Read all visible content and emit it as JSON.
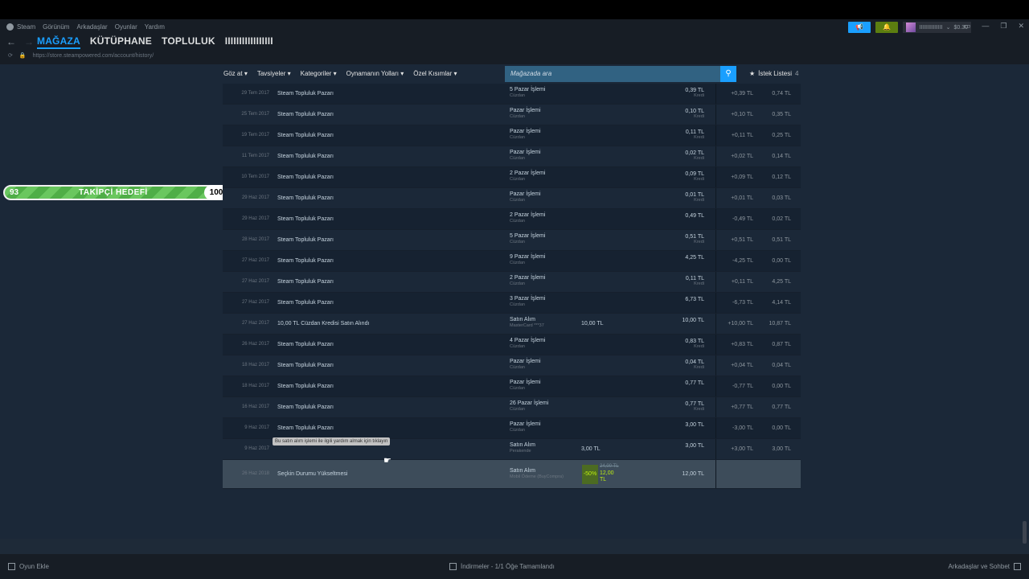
{
  "menu": {
    "steam": "Steam",
    "view": "Görünüm",
    "friends": "Arkadaşlar",
    "games": "Oyunlar",
    "help": "Yardım"
  },
  "tabs": {
    "store": "MAĞAZA",
    "library": "KÜTÜPHANE",
    "community": "TOPLULUK",
    "username": "IIIIIIIIIIIIIIIII"
  },
  "url": "https://store.steampowered.com/account/history/",
  "user": {
    "name": "IIIIIIIIIIIIIII",
    "balance": "$0.30"
  },
  "storenav": {
    "yourstore": "Göz at",
    "recommendations": "Tavsiyeler",
    "categories": "Kategoriler",
    "ways": "Oynamanın Yolları",
    "special": "Özel Kısımlar",
    "search_placeholder": "Mağazada ara",
    "wishlist": "İstek Listesi",
    "wishlist_count": "4"
  },
  "goal": {
    "start": "93",
    "label": "TAKİPÇİ HEDEFİ",
    "end": "100"
  },
  "rows": [
    {
      "date": "29 Tem 2017",
      "item": "Steam Topluluk Pazarı",
      "type": "5 Pazar İşlemi",
      "sub": "Cüzdan",
      "total": "",
      "amt": "0,39 TL",
      "amtsub": "Kredi",
      "change": "+0,39 TL",
      "bal": "0,74 TL"
    },
    {
      "date": "25 Tem 2017",
      "item": "Steam Topluluk Pazarı",
      "type": "Pazar İşlemi",
      "sub": "Cüzdan",
      "total": "",
      "amt": "0,10 TL",
      "amtsub": "Kredi",
      "change": "+0,10 TL",
      "bal": "0,35 TL"
    },
    {
      "date": "19 Tem 2017",
      "item": "Steam Topluluk Pazarı",
      "type": "Pazar İşlemi",
      "sub": "Cüzdan",
      "total": "",
      "amt": "0,11 TL",
      "amtsub": "Kredi",
      "change": "+0,11 TL",
      "bal": "0,25 TL"
    },
    {
      "date": "11 Tem 2017",
      "item": "Steam Topluluk Pazarı",
      "type": "Pazar İşlemi",
      "sub": "Cüzdan",
      "total": "",
      "amt": "0,02 TL",
      "amtsub": "Kredi",
      "change": "+0,02 TL",
      "bal": "0,14 TL"
    },
    {
      "date": "10 Tem 2017",
      "item": "Steam Topluluk Pazarı",
      "type": "2 Pazar İşlemi",
      "sub": "Cüzdan",
      "total": "",
      "amt": "0,09 TL",
      "amtsub": "Kredi",
      "change": "+0,09 TL",
      "bal": "0,12 TL"
    },
    {
      "date": "29 Haz 2017",
      "item": "Steam Topluluk Pazarı",
      "type": "Pazar İşlemi",
      "sub": "Cüzdan",
      "total": "",
      "amt": "0,01 TL",
      "amtsub": "Kredi",
      "change": "+0,01 TL",
      "bal": "0,03 TL"
    },
    {
      "date": "29 Haz 2017",
      "item": "Steam Topluluk Pazarı",
      "type": "2 Pazar İşlemi",
      "sub": "Cüzdan",
      "total": "",
      "amt": "0,49 TL",
      "amtsub": "",
      "change": "-0,49 TL",
      "bal": "0,02 TL"
    },
    {
      "date": "28 Haz 2017",
      "item": "Steam Topluluk Pazarı",
      "type": "5 Pazar İşlemi",
      "sub": "Cüzdan",
      "total": "",
      "amt": "0,51 TL",
      "amtsub": "Kredi",
      "change": "+0,51 TL",
      "bal": "0,51 TL"
    },
    {
      "date": "27 Haz 2017",
      "item": "Steam Topluluk Pazarı",
      "type": "9 Pazar İşlemi",
      "sub": "Cüzdan",
      "total": "",
      "amt": "4,25 TL",
      "amtsub": "",
      "change": "-4,25 TL",
      "bal": "0,00 TL"
    },
    {
      "date": "27 Haz 2017",
      "item": "Steam Topluluk Pazarı",
      "type": "2 Pazar İşlemi",
      "sub": "Cüzdan",
      "total": "",
      "amt": "0,11 TL",
      "amtsub": "Kredi",
      "change": "+0,11 TL",
      "bal": "4,25 TL"
    },
    {
      "date": "27 Haz 2017",
      "item": "Steam Topluluk Pazarı",
      "type": "3 Pazar İşlemi",
      "sub": "Cüzdan",
      "total": "",
      "amt": "6,73 TL",
      "amtsub": "",
      "change": "-6,73 TL",
      "bal": "4,14 TL"
    },
    {
      "date": "27 Haz 2017",
      "item": "10,00 TL Cüzdan Kredisi Satın Alındı",
      "type": "Satın Alım",
      "sub": "MasterCard ***37",
      "total": "10,00 TL",
      "amt": "10,00 TL",
      "amtsub": "",
      "change": "+10,00 TL",
      "bal": "10,87 TL"
    },
    {
      "date": "26 Haz 2017",
      "item": "Steam Topluluk Pazarı",
      "type": "4 Pazar İşlemi",
      "sub": "Cüzdan",
      "total": "",
      "amt": "0,83 TL",
      "amtsub": "Kredi",
      "change": "+0,83 TL",
      "bal": "0,87 TL"
    },
    {
      "date": "18 Haz 2017",
      "item": "Steam Topluluk Pazarı",
      "type": "Pazar İşlemi",
      "sub": "Cüzdan",
      "total": "",
      "amt": "0,04 TL",
      "amtsub": "Kredi",
      "change": "+0,04 TL",
      "bal": "0,04 TL"
    },
    {
      "date": "18 Haz 2017",
      "item": "Steam Topluluk Pazarı",
      "type": "Pazar İşlemi",
      "sub": "Cüzdan",
      "total": "",
      "amt": "0,77 TL",
      "amtsub": "",
      "change": "-0,77 TL",
      "bal": "0,00 TL"
    },
    {
      "date": "16 Haz 2017",
      "item": "Steam Topluluk Pazarı",
      "type": "26 Pazar İşlemi",
      "sub": "Cüzdan",
      "total": "",
      "amt": "0,77 TL",
      "amtsub": "Kredi",
      "change": "+0,77 TL",
      "bal": "0,77 TL"
    },
    {
      "date": "9 Haz 2017",
      "item": "Steam Topluluk Pazarı",
      "type": "Pazar İşlemi",
      "sub": "Cüzdan",
      "total": "",
      "amt": "3,00 TL",
      "amtsub": "",
      "change": "-3,00 TL",
      "bal": "0,00 TL"
    },
    {
      "date": "9 Haz 2017",
      "item": "",
      "type": "Satın Alım",
      "sub": "Perakende",
      "total": "3,00 TL",
      "amt": "3,00 TL",
      "amtsub": "",
      "change": "+3,00 TL",
      "bal": "3,00 TL"
    }
  ],
  "lastrow": {
    "date": "26 Haz 2018",
    "item": "Seçkin Durumu Yükseltmesi",
    "type": "Satın Alım",
    "sub": "Mobil Ödeme (BuyCompra)",
    "discount": "-50%",
    "orig": "24,00 TL",
    "final": "12,00 TL",
    "amt": "12,00 TL"
  },
  "tooltip": "Bu satın alım işlemi ile ilgili yardım almak için tıklayın",
  "footer": {
    "addgame": "Oyun Ekle",
    "downloads": "İndirmeler - 1/1 Öğe Tamamlandı",
    "friends": "Arkadaşlar ve Sohbet"
  }
}
